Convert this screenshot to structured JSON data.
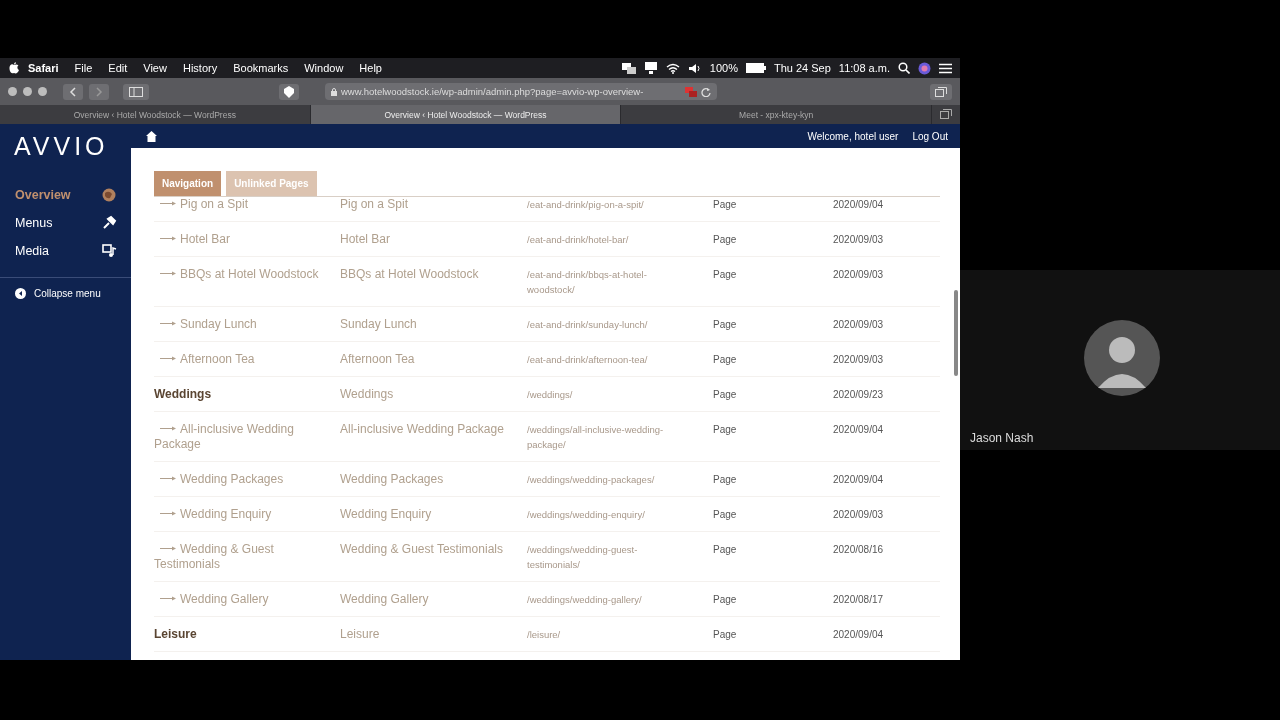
{
  "menubar": {
    "items": [
      {
        "label": "Safari",
        "kind": "app"
      },
      {
        "label": "File",
        "kind": "menu"
      },
      {
        "label": "Edit",
        "kind": "menu"
      },
      {
        "label": "View",
        "kind": "menu"
      },
      {
        "label": "History",
        "kind": "menu"
      },
      {
        "label": "Bookmarks",
        "kind": "menu"
      },
      {
        "label": "Window",
        "kind": "menu"
      },
      {
        "label": "Help",
        "kind": "menu"
      }
    ],
    "battery": "100%",
    "date": "Thu 24 Sep",
    "time": "11:08 a.m."
  },
  "browser": {
    "url": "www.hotelwoodstock.ie/wp-admin/admin.php?page=avvio-wp-overview-",
    "tabs": [
      {
        "title": "Overview ‹ Hotel Woodstock — WordPress",
        "selected": false
      },
      {
        "title": "Overview ‹ Hotel Woodstock — WordPress",
        "selected": true
      },
      {
        "title": "Meet - xpx-ktey-kyn",
        "selected": false
      }
    ]
  },
  "admin": {
    "logo": "AVVIO",
    "menu": [
      {
        "label": "Overview",
        "selected": true
      },
      {
        "label": "Menus",
        "selected": false
      },
      {
        "label": "Media",
        "selected": false
      }
    ],
    "collapse": "Collapse menu",
    "welcome": "Welcome, hotel user",
    "logout": "Log Out"
  },
  "content": {
    "tabs": [
      {
        "label": "Navigation",
        "selected": true
      },
      {
        "label": "Unlinked Pages",
        "selected": false
      }
    ],
    "rows": [
      {
        "kind": "child",
        "title": "Pig on a Spit",
        "label": "Pig on a Spit",
        "url": "/eat-and-drink/pig-on-a-spit/",
        "type": "Page",
        "date": "2020/09/04"
      },
      {
        "kind": "child",
        "title": "Hotel Bar",
        "label": "Hotel Bar",
        "url": "/eat-and-drink/hotel-bar/",
        "type": "Page",
        "date": "2020/09/03"
      },
      {
        "kind": "child",
        "title": "BBQs at Hotel Woodstock",
        "label": "BBQs at Hotel Woodstock",
        "url": "/eat-and-drink/bbqs-at-hotel-woodstock/",
        "type": "Page",
        "date": "2020/09/03"
      },
      {
        "kind": "child",
        "title": "Sunday Lunch",
        "label": "Sunday Lunch",
        "url": "/eat-and-drink/sunday-lunch/",
        "type": "Page",
        "date": "2020/09/03"
      },
      {
        "kind": "child",
        "title": "Afternoon Tea",
        "label": "Afternoon Tea",
        "url": "/eat-and-drink/afternoon-tea/",
        "type": "Page",
        "date": "2020/09/03"
      },
      {
        "kind": "parent",
        "title": "Weddings",
        "label": "Weddings",
        "url": "/weddings/",
        "type": "Page",
        "date": "2020/09/23"
      },
      {
        "kind": "child",
        "title": "All-inclusive Wedding Package",
        "label": "All-inclusive Wedding Package",
        "url": "/weddings/all-inclusive-wedding-package/",
        "type": "Page",
        "date": "2020/09/04"
      },
      {
        "kind": "child",
        "title": "Wedding Packages",
        "label": "Wedding Packages",
        "url": "/weddings/wedding-packages/",
        "type": "Page",
        "date": "2020/09/04"
      },
      {
        "kind": "child",
        "title": "Wedding Enquiry",
        "label": "Wedding Enquiry",
        "url": "/weddings/wedding-enquiry/",
        "type": "Page",
        "date": "2020/09/03"
      },
      {
        "kind": "child",
        "title": "Wedding & Guest Testimonials",
        "label": "Wedding & Guest Testimonials",
        "url": "/weddings/wedding-guest-testimonials/",
        "type": "Page",
        "date": "2020/08/16"
      },
      {
        "kind": "child",
        "title": "Wedding Gallery",
        "label": "Wedding Gallery",
        "url": "/weddings/wedding-gallery/",
        "type": "Page",
        "date": "2020/08/17"
      },
      {
        "kind": "parent",
        "title": "Leisure",
        "label": "Leisure",
        "url": "/leisure/",
        "type": "Page",
        "date": "2020/09/04"
      }
    ]
  },
  "call": {
    "participant": "Jason Nash"
  }
}
